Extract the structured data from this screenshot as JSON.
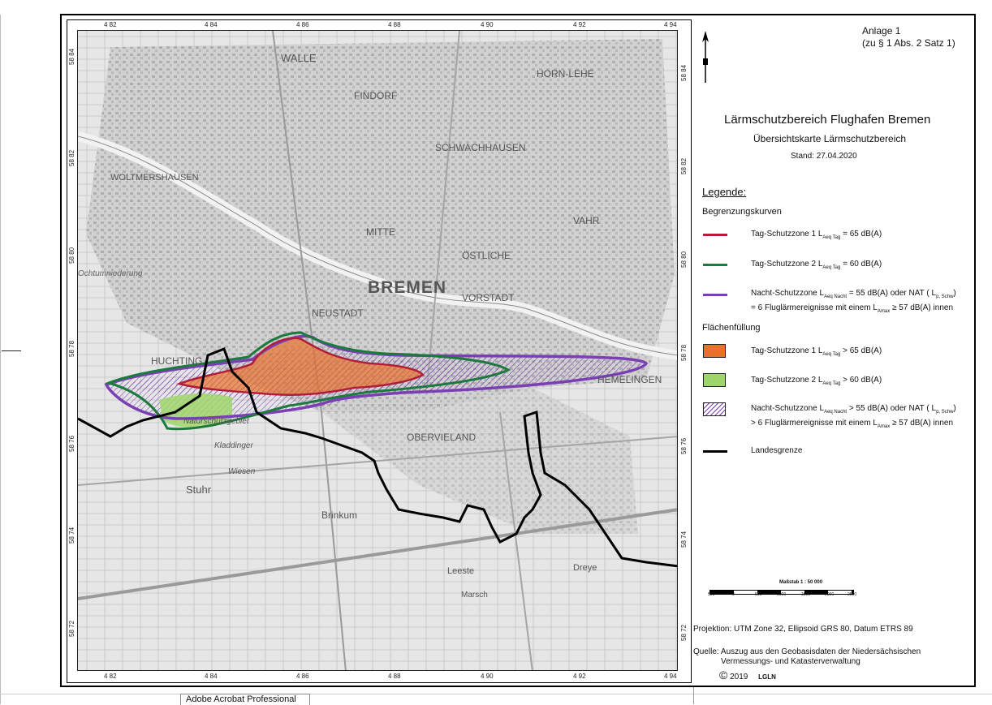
{
  "map": {
    "grid_x": [
      "4 82",
      "4 84",
      "4 86",
      "4 88",
      "4 90",
      "4 92",
      "4 94"
    ],
    "grid_y": [
      "58 84",
      "58 82",
      "58 80",
      "58 78",
      "58 76",
      "58 74",
      "58 72"
    ],
    "place_names": [
      "WALLE",
      "FINDORF",
      "HORN-LEHE",
      "SCHWACHHAUSEN",
      "WOLTMERSHAUSEN",
      "VAHR",
      "MITTE",
      "ÖSTLICHE",
      "BREMEN",
      "VORSTADT",
      "NEUSTADT",
      "HUCHTING",
      "HEMELINGEN",
      "OBERVIELAND",
      "Naturschutzgebiet",
      "Kladdinger",
      "Wiesen",
      "Stuhr",
      "Brinkum",
      "Leeste",
      "Marsch",
      "Dreye",
      "Kattenesch",
      "Ochtumniederung"
    ],
    "colors": {
      "tag1": "#b21e3a",
      "tag2": "#1d7a3e",
      "nacht": "#7b3fb4",
      "fill1": "#e8712b",
      "fill2": "#9fd66b",
      "landesgrenze": "#000000"
    }
  },
  "panel": {
    "annex_line1": "Anlage 1",
    "annex_line2": "(zu § 1 Abs. 2 Satz 1)",
    "title": "Lärmschutzbereich Flughafen Bremen",
    "subtitle": "Übersichtskarte Lärmschutzbereich",
    "stand": "Stand: 27.04.2020",
    "legend_heading": "Legende:",
    "section_curves": "Begrenzungskurven",
    "section_fill": "Flächenfüllung",
    "curve_tag1": "Tag-Schutzzone 1  L",
    "curve_tag1_sub": "Aeq Tag",
    "curve_tag1_val": " = 65 dB(A)",
    "curve_tag2": "Tag-Schutzzone 2  L",
    "curve_tag2_sub": "Aeq Tag",
    "curve_tag2_val": " = 60 dB(A)",
    "curve_nacht_a": "Nacht-Schutzzone  L",
    "curve_nacht_sub": "Aeq Nacht",
    "curve_nacht_b": " = 55 dB(A) oder NAT ( L",
    "curve_nacht_sub2": "p, Schw",
    "curve_nacht_c": ")",
    "curve_nacht_line2a": "= 6 Fluglärmereignisse mit einem L",
    "curve_nacht_line2sub": "Amax",
    "curve_nacht_line2b": " ≥ 57 dB(A) innen",
    "fill_tag1": "Tag-Schutzzone 1  L",
    "fill_tag1_sub": "Aeq Tag",
    "fill_tag1_val": "  > 65 dB(A)",
    "fill_tag2": "Tag-Schutzzone 2  L",
    "fill_tag2_sub": "Aeq Tag",
    "fill_tag2_val": "  > 60 dB(A)",
    "fill_nacht_a": "Nacht-Schutzzone  L",
    "fill_nacht_sub": "Aeq Nacht",
    "fill_nacht_b": " > 55 dB(A) oder NAT ( L",
    "fill_nacht_sub2": "p, Schw",
    "fill_nacht_c": ")",
    "fill_nacht_line2a": "> 6 Fluglärmereignisse mit einem L",
    "fill_nacht_line2sub": "Amax",
    "fill_nacht_line2b": " ≥ 57 dB(A) innen",
    "landesgrenze": "Landesgrenze",
    "scale_label": "Maßstab  1 : 50 000",
    "scale_ticks": [
      "500",
      "0",
      "500",
      "1000",
      "1500",
      "2000",
      "2500"
    ],
    "projection": "Projektion:   UTM Zone 32, Ellipsoid GRS 80, Datum ETRS 89",
    "source_line1": "Quelle:  Auszug aus den Geobasisdaten der Niedersächsischen",
    "source_line2": "Vermessungs- und Katasterverwaltung",
    "copyright": "2019",
    "lgln": "LGLN"
  },
  "footer": {
    "tab_label": "Adobe Acrobat Professional"
  }
}
